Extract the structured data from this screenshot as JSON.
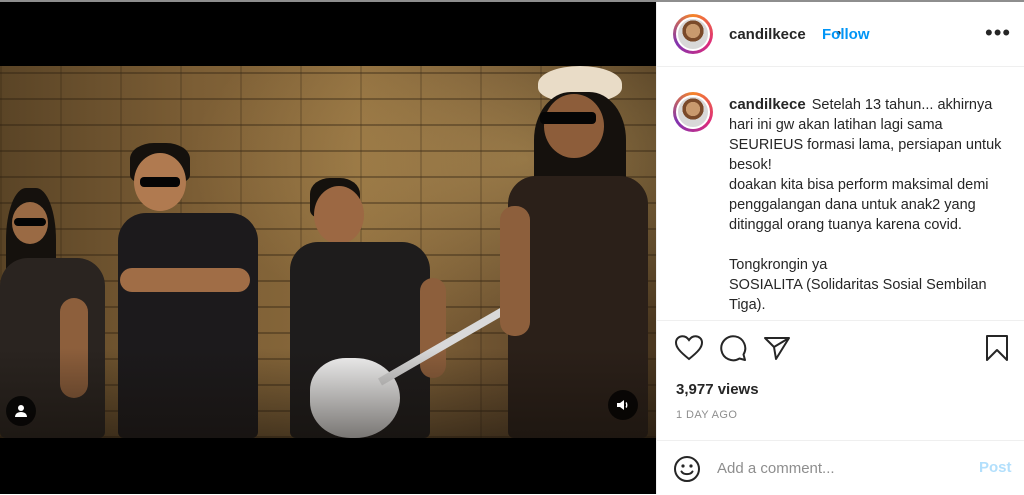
{
  "post": {
    "username": "candilkece",
    "separator": "•",
    "follow_label": "Follow",
    "more_label": "•••",
    "caption_lines": [
      "Setelah 13 tahun... akhirnya",
      "hari ini gw akan latihan lagi sama",
      "SEURIEUS formasi lama, persiapan untuk",
      "besok!",
      "doakan kita bisa perform maksimal demi",
      "penggalangan dana untuk anak2 yang",
      "ditinggal orang tuanya karena covid.",
      "",
      "Tongkrongin ya",
      "SOSIALITA (Solidaritas Sosial Sembilan",
      "Tiga)."
    ],
    "views": "3,977 views",
    "timestamp": "1 DAY AGO"
  },
  "comment": {
    "placeholder": "Add a comment...",
    "post_label": "Post"
  },
  "colors": {
    "accent": "#0095f6",
    "post_disabled": "#b2dffc",
    "text": "#262626",
    "muted": "#8e8e8e"
  },
  "icons": {
    "like": "heart-icon",
    "comment": "comment-icon",
    "share": "paper-plane-icon",
    "save": "bookmark-icon",
    "emoji": "smiley-icon",
    "user_tag": "user-icon",
    "sound": "speaker-icon"
  }
}
